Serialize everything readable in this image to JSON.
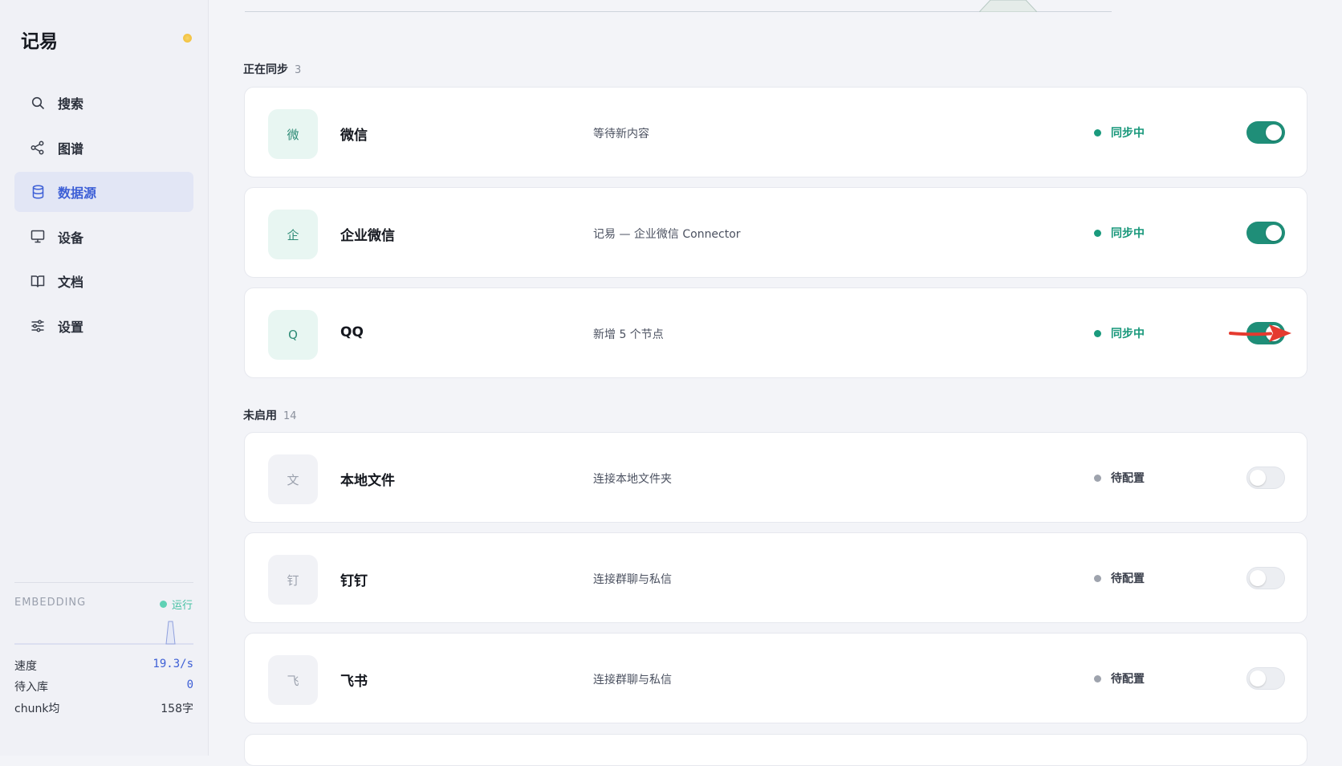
{
  "app": {
    "title": "记易"
  },
  "sidebar": {
    "items": [
      {
        "label": "搜索",
        "icon": "search-icon"
      },
      {
        "label": "图谱",
        "icon": "share-graph-icon"
      },
      {
        "label": "数据源",
        "icon": "database-icon",
        "active": true
      },
      {
        "label": "设备",
        "icon": "monitor-icon"
      },
      {
        "label": "文档",
        "icon": "book-icon"
      },
      {
        "label": "设置",
        "icon": "sliders-icon"
      }
    ],
    "embedding": {
      "title": "EMBEDDING",
      "status": "运行",
      "stats": [
        {
          "key": "速度",
          "value": "19.3/s"
        },
        {
          "key": "待入库",
          "value": "0"
        },
        {
          "key": "chunk均",
          "value": "158字"
        }
      ]
    }
  },
  "main": {
    "sections": [
      {
        "title": "正在同步",
        "count": "3",
        "cards": [
          {
            "badge": "微",
            "name": "微信",
            "desc": "等待新内容",
            "status": "同步中",
            "enabled": true
          },
          {
            "badge": "企",
            "name": "企业微信",
            "desc": "记易 — 企业微信 Connector",
            "status": "同步中",
            "enabled": true
          },
          {
            "badge": "Q",
            "name": "QQ",
            "desc": "新增 5 个节点",
            "status": "同步中",
            "enabled": true
          }
        ]
      },
      {
        "title": "未启用",
        "count": "14",
        "cards": [
          {
            "badge": "文",
            "name": "本地文件",
            "desc": "连接本地文件夹",
            "status": "待配置",
            "enabled": false
          },
          {
            "badge": "钉",
            "name": "钉钉",
            "desc": "连接群聊与私信",
            "status": "待配置",
            "enabled": false
          },
          {
            "badge": "飞",
            "name": "飞书",
            "desc": "连接群聊与私信",
            "status": "待配置",
            "enabled": false
          }
        ]
      }
    ]
  },
  "colors": {
    "accent": "#3d5fd6",
    "sync_green": "#1a9a7d",
    "toggle_on": "#1f8e78",
    "arrow_red": "#e53a2f"
  }
}
